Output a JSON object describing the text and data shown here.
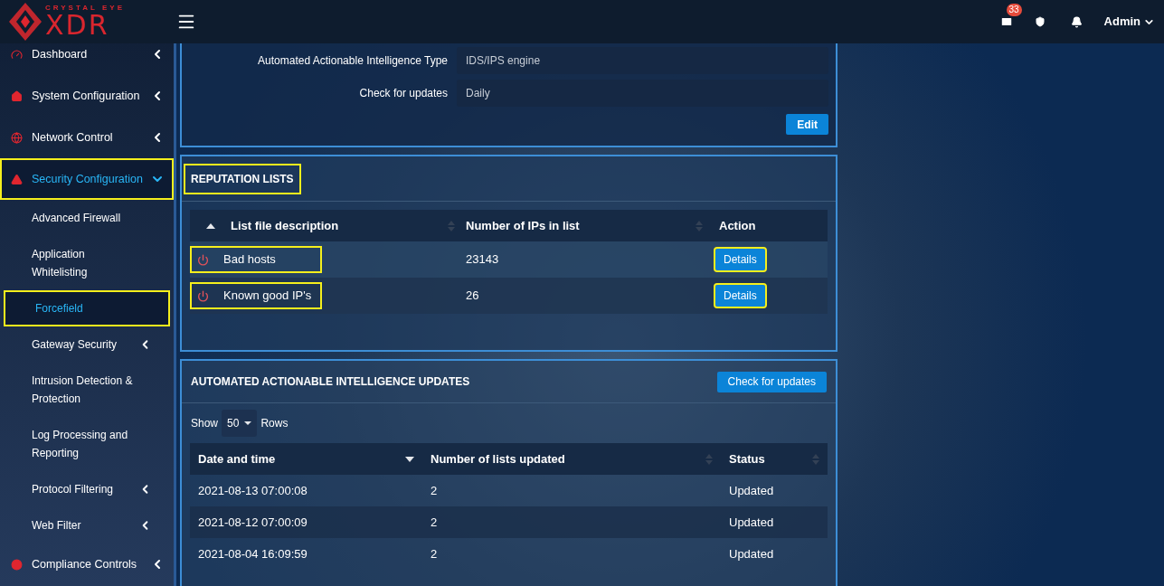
{
  "logo": {
    "top_text": "CRYSTAL EYE",
    "main_text": "XDR"
  },
  "header": {
    "mail_badge": "33",
    "user": "Admin"
  },
  "sidebar": {
    "items": [
      {
        "label": "Dashboard",
        "selected": false,
        "highlighted": false,
        "expanded": false,
        "has_children": true
      },
      {
        "label": "System Configuration",
        "selected": false,
        "highlighted": false,
        "expanded": false,
        "has_children": true
      },
      {
        "label": "Network Control",
        "selected": false,
        "highlighted": false,
        "expanded": false,
        "has_children": true
      },
      {
        "label": "Security Configuration",
        "selected": true,
        "highlighted": true,
        "expanded": true,
        "has_children": true,
        "children": [
          {
            "label": "Advanced Firewall",
            "selected": false,
            "highlighted": false,
            "has_children": false
          },
          {
            "label": "Application Whitelisting",
            "selected": false,
            "highlighted": false,
            "has_children": false
          },
          {
            "label": "Forcefield",
            "selected": true,
            "highlighted": true,
            "has_children": false
          },
          {
            "label": "Gateway Security",
            "selected": false,
            "highlighted": false,
            "has_children": true
          },
          {
            "label": "Intrusion Detection & Protection",
            "selected": false,
            "highlighted": false,
            "has_children": false
          },
          {
            "label": "Log Processing and Reporting",
            "selected": false,
            "highlighted": false,
            "has_children": false
          },
          {
            "label": "Protocol Filtering",
            "selected": false,
            "highlighted": false,
            "has_children": true
          },
          {
            "label": "Web Filter",
            "selected": false,
            "highlighted": false,
            "has_children": true
          }
        ]
      },
      {
        "label": "Compliance Controls",
        "selected": false,
        "highlighted": false,
        "expanded": false,
        "has_children": true
      }
    ]
  },
  "properties": {
    "fields": [
      {
        "label": "Automated Actionable Intelligence Type",
        "value": "IDS/IPS engine"
      },
      {
        "label": "Check for updates",
        "value": "Daily"
      }
    ],
    "edit_button": "Edit"
  },
  "reputation_lists": {
    "title": "REPUTATION LISTS",
    "title_highlighted": true,
    "columns": [
      {
        "label": "List file description"
      },
      {
        "label": "Number of IPs in list"
      },
      {
        "label": "Action"
      }
    ],
    "rows": [
      {
        "name": "Bad hosts",
        "count": "23143",
        "action": "Details",
        "name_highlighted": true,
        "action_highlighted": true
      },
      {
        "name": "Known good IP's",
        "count": "26",
        "action": "Details",
        "name_highlighted": true,
        "action_highlighted": true
      }
    ]
  },
  "updates": {
    "title": "AUTOMATED ACTIONABLE INTELLIGENCE UPDATES",
    "check_button": "Check for updates",
    "show_label": "Show",
    "rows_per_page": "50",
    "rows_label": "Rows",
    "columns": [
      {
        "label": "Date and time"
      },
      {
        "label": "Number of lists updated"
      },
      {
        "label": "Status"
      }
    ],
    "rows": [
      {
        "date": "2021-08-13 07:00:08",
        "lists": "2",
        "status": "Updated"
      },
      {
        "date": "2021-08-12 07:00:09",
        "lists": "2",
        "status": "Updated"
      },
      {
        "date": "2021-08-04 16:09:59",
        "lists": "2",
        "status": "Updated"
      }
    ]
  }
}
